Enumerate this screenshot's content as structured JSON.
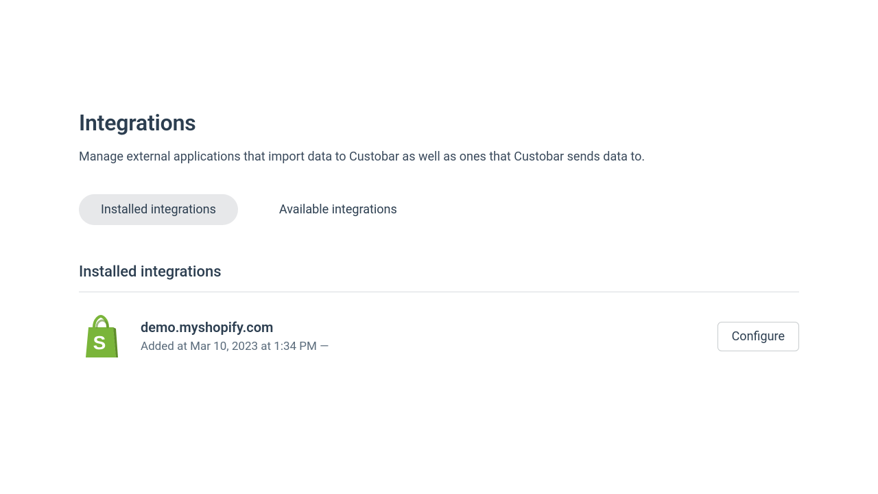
{
  "header": {
    "title": "Integrations",
    "subtitle": "Manage external applications that import data to Custobar as well as ones that Custobar sends data to."
  },
  "tabs": {
    "installed": "Installed integrations",
    "available": "Available integrations"
  },
  "section": {
    "title": "Installed integrations"
  },
  "integrations": [
    {
      "icon": "shopify",
      "name": "demo.myshopify.com",
      "meta": "Added at Mar 10, 2023 at 1:34 PM  —",
      "action": "Configure"
    }
  ]
}
